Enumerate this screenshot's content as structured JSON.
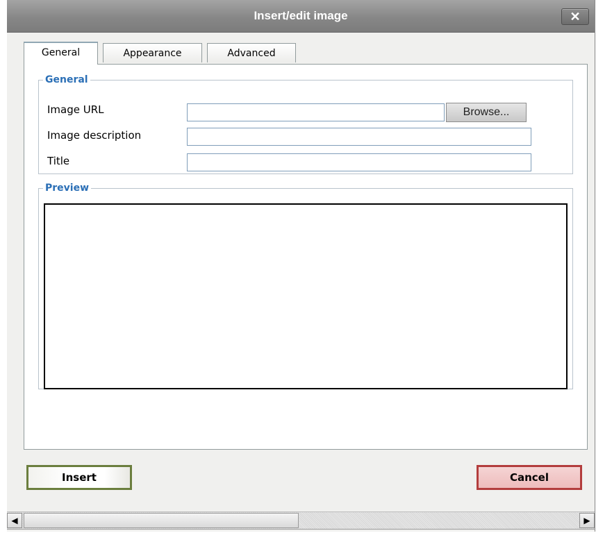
{
  "window": {
    "title": "Insert/edit image",
    "close_label": "✕"
  },
  "tabs": [
    {
      "label": "General",
      "active": true
    },
    {
      "label": "Appearance",
      "active": false
    },
    {
      "label": "Advanced",
      "active": false
    }
  ],
  "general": {
    "legend": "General",
    "image_url_label": "Image URL",
    "image_url_value": "",
    "browse_label": "Browse...",
    "image_description_label": "Image description",
    "image_description_value": "",
    "title_label": "Title",
    "title_value": ""
  },
  "preview": {
    "legend": "Preview"
  },
  "actions": {
    "insert_label": "Insert",
    "cancel_label": "Cancel"
  },
  "scrollbar": {
    "left_arrow": "◀",
    "right_arrow": "▶"
  },
  "colors": {
    "legend": "#2b6fb6",
    "insert_border": "#6b7e3e",
    "cancel_border": "#b33d3d"
  }
}
